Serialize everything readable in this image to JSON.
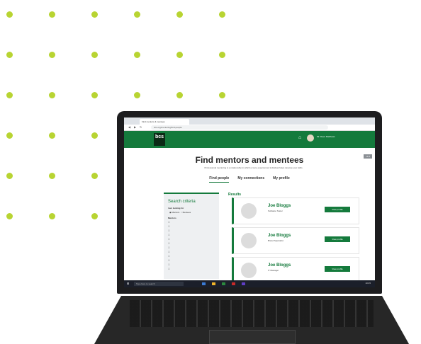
{
  "browser": {
    "tab_title": "Find mentors & mentees",
    "url": "bcs.org/mentoring/find-people"
  },
  "header": {
    "logo_text": "bcs",
    "user_name": "Mr. Dave Matthews"
  },
  "page": {
    "title": "Find mentors and mentees",
    "subtitle": "Professional mentoring is a relationship in which a more experienced individual helps develop your skills.",
    "version_badge": "v1.0",
    "tabs": [
      "Find people",
      "My connections",
      "My profile"
    ]
  },
  "search": {
    "title": "Search criteria",
    "looking_for_label": "I am looking for",
    "options": [
      "Mentors",
      "Mentees"
    ],
    "mentor_label": "Mentors",
    "checkboxes": [
      "",
      "",
      "",
      "",
      "",
      "",
      "",
      "",
      "",
      "",
      "",
      ""
    ]
  },
  "results": {
    "title": "Results",
    "items": [
      {
        "name": "Joe Bloggs",
        "role": "Software Tester",
        "button": "View profile"
      },
      {
        "name": "Joe Bloggs",
        "role": "Brand Specialist",
        "button": "View profile"
      },
      {
        "name": "Joe Bloggs",
        "role": "IT Manager",
        "button": "View profile"
      }
    ]
  },
  "taskbar": {
    "search_placeholder": "Type here to search",
    "time": "10:45"
  },
  "colors": {
    "accent": "#147a3c",
    "dots": "#b8d432"
  }
}
